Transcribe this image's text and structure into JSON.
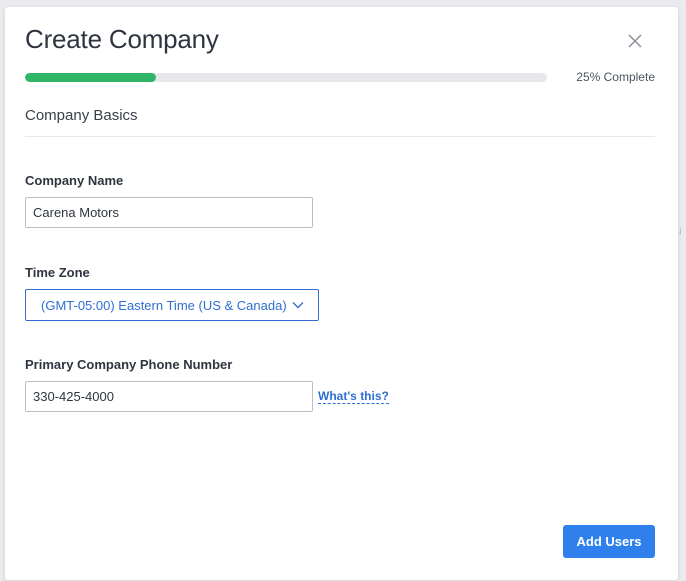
{
  "background": {
    "fragment_text": "u"
  },
  "modal": {
    "title": "Create Company",
    "close_icon": "close-icon",
    "progress": {
      "fraction": 0.25,
      "label": "25% Complete",
      "color": "#2fb566"
    },
    "section_title": "Company Basics",
    "fields": {
      "company_name": {
        "label": "Company Name",
        "value": "Carena Motors"
      },
      "time_zone": {
        "label": "Time Zone",
        "selected": "(GMT-05:00) Eastern Time (US & Canada)",
        "icon": "chevron-down-icon"
      },
      "phone": {
        "label": "Primary Company Phone Number",
        "value": "330-425-4000",
        "help_link": "What's this?"
      }
    },
    "primary_button": {
      "label": "Add Users",
      "color": "#2f80ed"
    }
  }
}
